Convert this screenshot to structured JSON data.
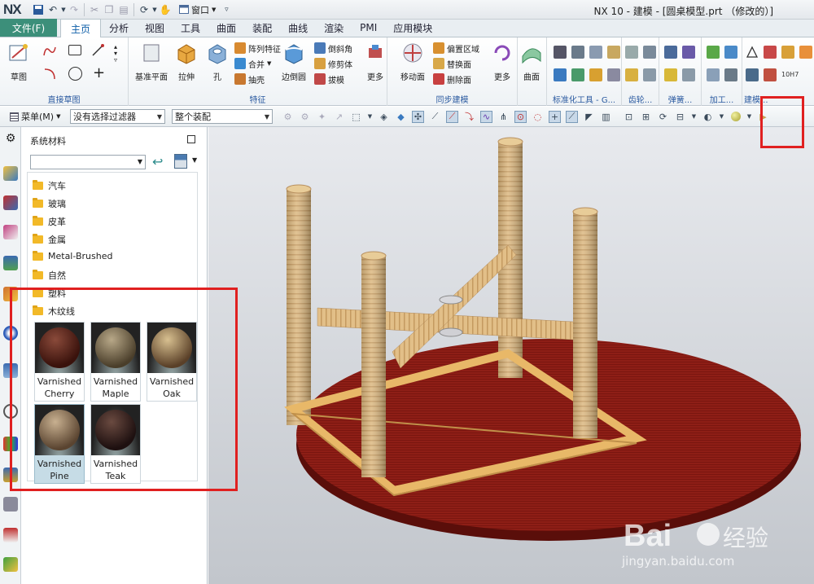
{
  "app": {
    "logo": "NX",
    "window_menu": "窗口",
    "title": "NX 10 - 建模 - [圆桌模型.prt （修改的）]"
  },
  "tabs": [
    {
      "label": "文件(F)"
    },
    {
      "label": "主页"
    },
    {
      "label": "分析"
    },
    {
      "label": "视图"
    },
    {
      "label": "工具"
    },
    {
      "label": "曲面"
    },
    {
      "label": "装配"
    },
    {
      "label": "曲线"
    },
    {
      "label": "渲染"
    },
    {
      "label": "PMI"
    },
    {
      "label": "应用模块"
    }
  ],
  "ribbon": {
    "sketch_group": {
      "sketch": "草图",
      "label": "直接草图"
    },
    "feature_group": {
      "datum_plane": "基准平面",
      "extrude": "拉伸",
      "hole": "孔",
      "pattern": "阵列特征",
      "unite": "合并",
      "shell": "抽壳",
      "edge_blend": "边倒圆",
      "chamfer": "倒斜角",
      "trim_body": "修剪体",
      "draft": "拔模",
      "more": "更多",
      "label": "特征"
    },
    "sync_group": {
      "move_face": "移动面",
      "offset_region": "偏置区域",
      "replace_face": "替换面",
      "delete_face": "删除面",
      "more": "更多",
      "label": "同步建模"
    },
    "surface_group": {
      "surface": "曲面"
    },
    "standard_tools_label": "标准化工具 - G...",
    "gear_label": "齿轮...",
    "spring_label": "弹簧...",
    "machining_label": "加工...",
    "modeling_label": "建模...",
    "extra_label": "10H7"
  },
  "cmdbar": {
    "menu": "菜单(M)",
    "filter": "没有选择过滤器",
    "assembly": "整个装配"
  },
  "palette": {
    "title": "系统材料",
    "folders": [
      "汽车",
      "玻璃",
      "皮革",
      "金属",
      "Metal-Brushed",
      "自然",
      "塑料",
      "木纹线"
    ],
    "materials": [
      {
        "line1": "Varnished",
        "line2": "Cherry",
        "color": "#4a1e16"
      },
      {
        "line1": "Varnished",
        "line2": "Maple",
        "color": "#7a6a4e"
      },
      {
        "line1": "Varnished",
        "line2": "Oak",
        "color": "#9a7a50"
      },
      {
        "line1": "Varnished",
        "line2": "Pine",
        "color": "#8a7050"
      },
      {
        "line1": "Varnished",
        "line2": "Teak",
        "color": "#3a2220"
      }
    ]
  },
  "watermark": {
    "brand": "Bai",
    "brand2": "经验",
    "url": "jingyan.baidu.com"
  },
  "colors": {
    "file_tab": "#3c8f7a",
    "active_tab_text": "#0d5ea8",
    "highlight_box": "#e02020",
    "table_top": "#8a1c14",
    "wood": "#d9b47c"
  }
}
